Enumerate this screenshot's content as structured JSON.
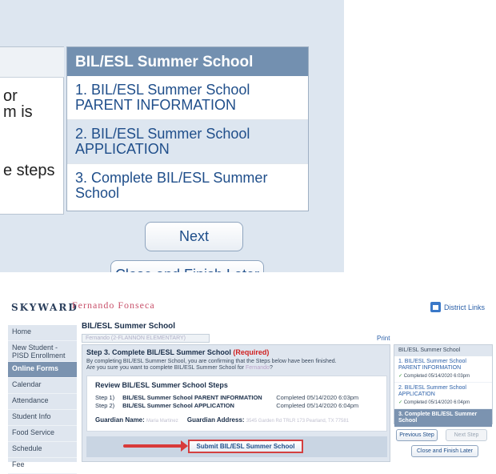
{
  "zoom": {
    "left_fragments": [
      "or",
      "m is",
      "e steps"
    ],
    "panel_title": "BIL/ESL Summer School",
    "panel_items": [
      "1. BIL/ESL Summer School PARENT INFORMATION",
      "2. BIL/ESL Summer School APPLICATION",
      "3. Complete BIL/ESL Summer School"
    ],
    "next_label": "Next",
    "close_label": "Close and Finish Later"
  },
  "header": {
    "logo": "SKYWARD",
    "user_name": "Fernando Fonseca",
    "district_links": "District Links"
  },
  "sidenav": {
    "items": [
      {
        "label": "Home"
      },
      {
        "label": "New Student - PISD Enrollment"
      },
      {
        "label": "Online Forms"
      },
      {
        "label": "Calendar"
      },
      {
        "label": "Attendance"
      },
      {
        "label": "Student Info"
      },
      {
        "label": "Food Service"
      },
      {
        "label": "Schedule"
      },
      {
        "label": "Fee"
      }
    ]
  },
  "form": {
    "title": "BIL/ESL Summer School",
    "student_tab": "Fernando (2-FLANNON ELEMENTARY)",
    "print": "Print",
    "step_title": "Step 3. Complete BIL/ESL Summer School",
    "required": "(Required)",
    "confirm_line1": "By completing BIL/ESL Summer School, you are confirming that the Steps below have been finished.",
    "confirm_line2a": "Are you sure you want to complete BIL/ESL Summer School for",
    "confirm_name": "Fernando",
    "confirm_line2b": "?",
    "review_title": "Review BIL/ESL Summer School Steps",
    "steps": [
      {
        "num": "Step 1)",
        "name": "BIL/ESL Summer School PARENT INFORMATION",
        "completed": "Completed 05/14/2020 6:03pm"
      },
      {
        "num": "Step 2)",
        "name": "BIL/ESL Summer School APPLICATION",
        "completed": "Completed 05/14/2020 6:04pm"
      }
    ],
    "guardian_name_label": "Guardian Name:",
    "guardian_name_value": "Maria Martinez",
    "guardian_address_label": "Guardian Address:",
    "guardian_address_value": "3545 Garden Rd TRLR 173 Pearland, TX 77581",
    "submit_label": "Submit BIL/ESL Summer School"
  },
  "steps_panel": {
    "title": "BIL/ESL Summer School",
    "items": [
      {
        "label": "1. BIL/ESL Summer School PARENT INFORMATION",
        "completed": "Completed 05/14/2020 6:03pm"
      },
      {
        "label": "2. BIL/ESL Summer School APPLICATION",
        "completed": "Completed 05/14/2020 6:04pm"
      },
      {
        "label": "3. Complete BIL/ESL Summer School"
      }
    ],
    "check": "✓",
    "prev_label": "Previous Step",
    "next_label": "Next Step",
    "close_label": "Close and Finish Later"
  }
}
